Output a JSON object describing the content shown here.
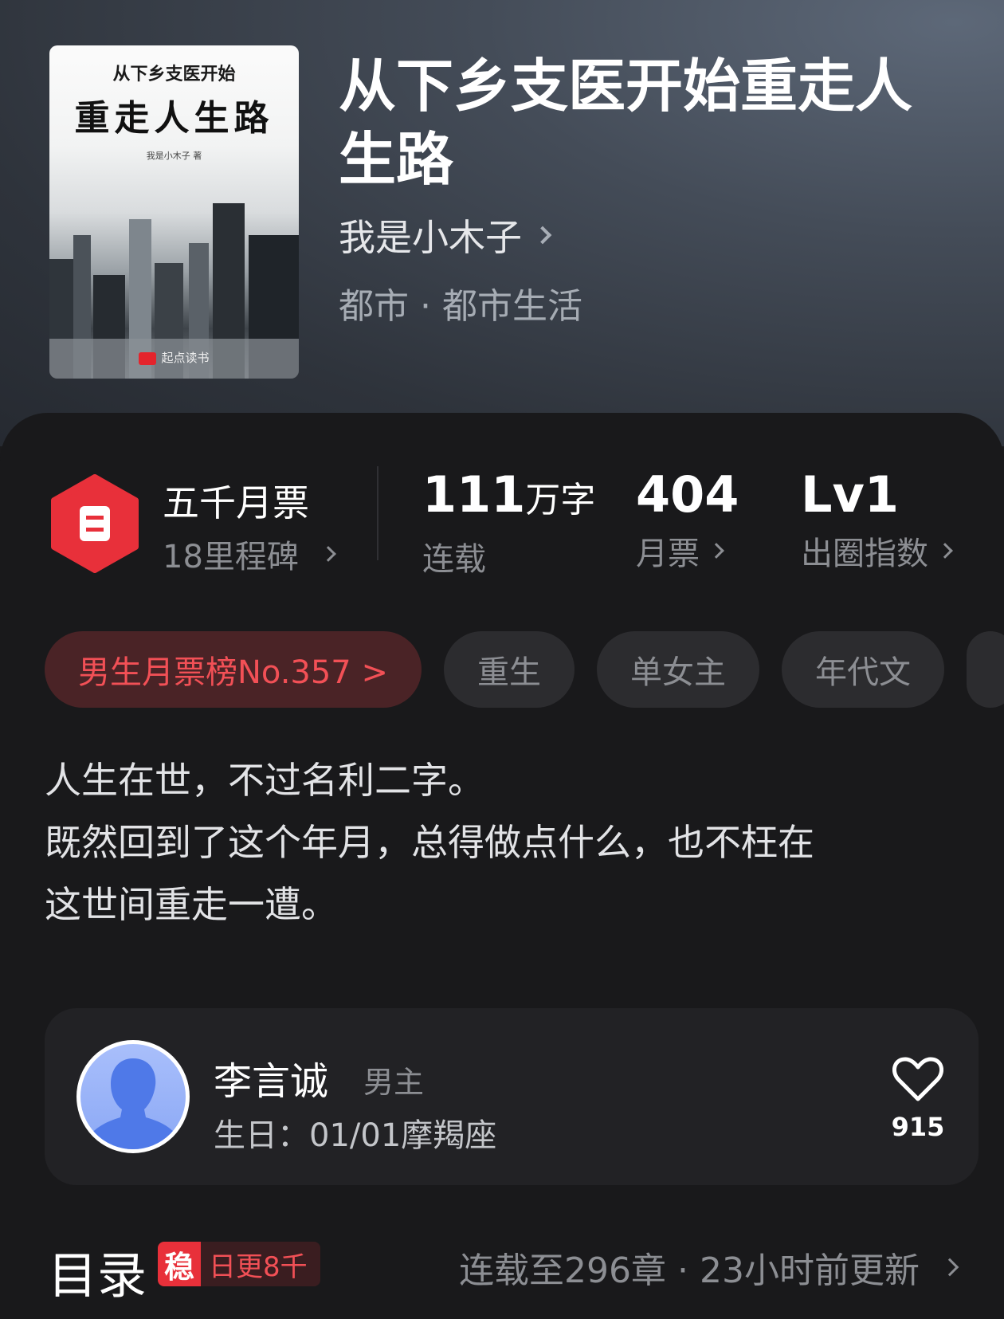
{
  "book": {
    "cover": {
      "subtitle": "从下乡支医开始",
      "title": "重走人生路",
      "author_line": "我是小木子 著",
      "brand": "起点读书"
    },
    "title": "从下乡支医开始重走人生路",
    "author": "我是小木子",
    "genre": "都市 · 都市生活"
  },
  "milestone": {
    "title": "五千月票",
    "subtitle": "18里程碑"
  },
  "stats": {
    "words_value": "111",
    "words_unit": "万字",
    "words_label": "连载",
    "votes_value": "404",
    "votes_label": "月票",
    "level_value": "Lv1",
    "level_label": "出圈指数"
  },
  "tags": {
    "rank": "男生月票榜No.357 >",
    "t1": "重生",
    "t2": "单女主",
    "t3": "年代文"
  },
  "intro": {
    "line1": "人生在世，不过名利二字。",
    "line2": "既然回到了这个年月，总得做点什么，也不枉在",
    "line3": "这世间重走一遭。"
  },
  "character": {
    "name": "李言诚",
    "role": "男主",
    "birthday": "生日：01/01摩羯座",
    "likes": "915"
  },
  "toc": {
    "title": "目录",
    "stable_mark": "稳",
    "stable_text": "日更8千",
    "status": "连载至296章 · 23小时前更新"
  },
  "colors": {
    "accent": "#e8303a",
    "rank_bg": "#4a2326",
    "panel_bg": "#19191b"
  }
}
